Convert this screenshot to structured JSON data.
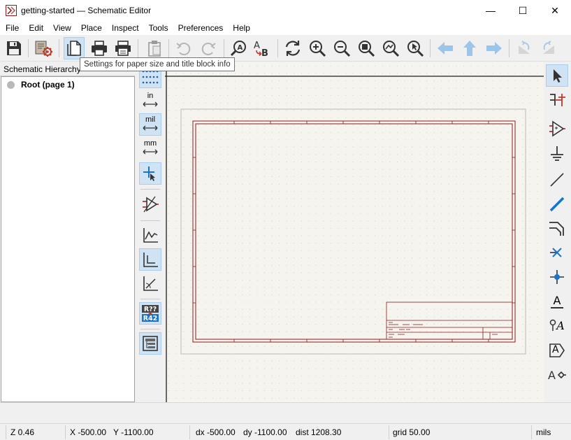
{
  "window": {
    "title": "getting-started — Schematic Editor",
    "minimize_glyph": "—",
    "maximize_glyph": "☐",
    "close_glyph": "✕"
  },
  "menu": [
    "File",
    "Edit",
    "View",
    "Place",
    "Inspect",
    "Tools",
    "Preferences",
    "Help"
  ],
  "toolbar": {
    "tooltip": "Settings for paper size and title block info",
    "icons": [
      "save-icon",
      "schematic-setup-icon",
      "page-settings-icon",
      "print-icon",
      "plot-icon",
      "paste-icon",
      "undo-icon",
      "redo-icon",
      "find-icon",
      "find-replace-icon",
      "refresh-icon",
      "zoom-in-icon",
      "zoom-out-icon",
      "zoom-fit-icon",
      "zoom-objects-icon",
      "zoom-selection-icon",
      "navigate-back-icon",
      "navigate-up-icon",
      "navigate-forward-icon",
      "rotate-ccw-icon",
      "rotate-cw-icon"
    ]
  },
  "hierarchy": {
    "header": "Schematic Hierarchy",
    "root_item": "Root (page 1)"
  },
  "left_tools": {
    "unit_in": "in",
    "unit_mil": "mil",
    "unit_mm": "mm",
    "annotate_top": "R??",
    "annotate_bottom": "R42"
  },
  "right_tools": {
    "text_label": "A",
    "net_label": "A",
    "text_box_label": "A"
  },
  "status": {
    "zoom": "Z 0.46",
    "x": "X -500.00",
    "y": "Y -1100.00",
    "dx": "dx -500.00",
    "dy": "dy -1100.00",
    "dist": "dist 1208.30",
    "grid": "grid 50.00",
    "units": "mils"
  },
  "colors": {
    "accent_blue": "#1a73c9",
    "sheet_border": "#8b1a1a",
    "canvas_bg": "#f5f4ef",
    "active_tool": "#cfe3f5"
  }
}
